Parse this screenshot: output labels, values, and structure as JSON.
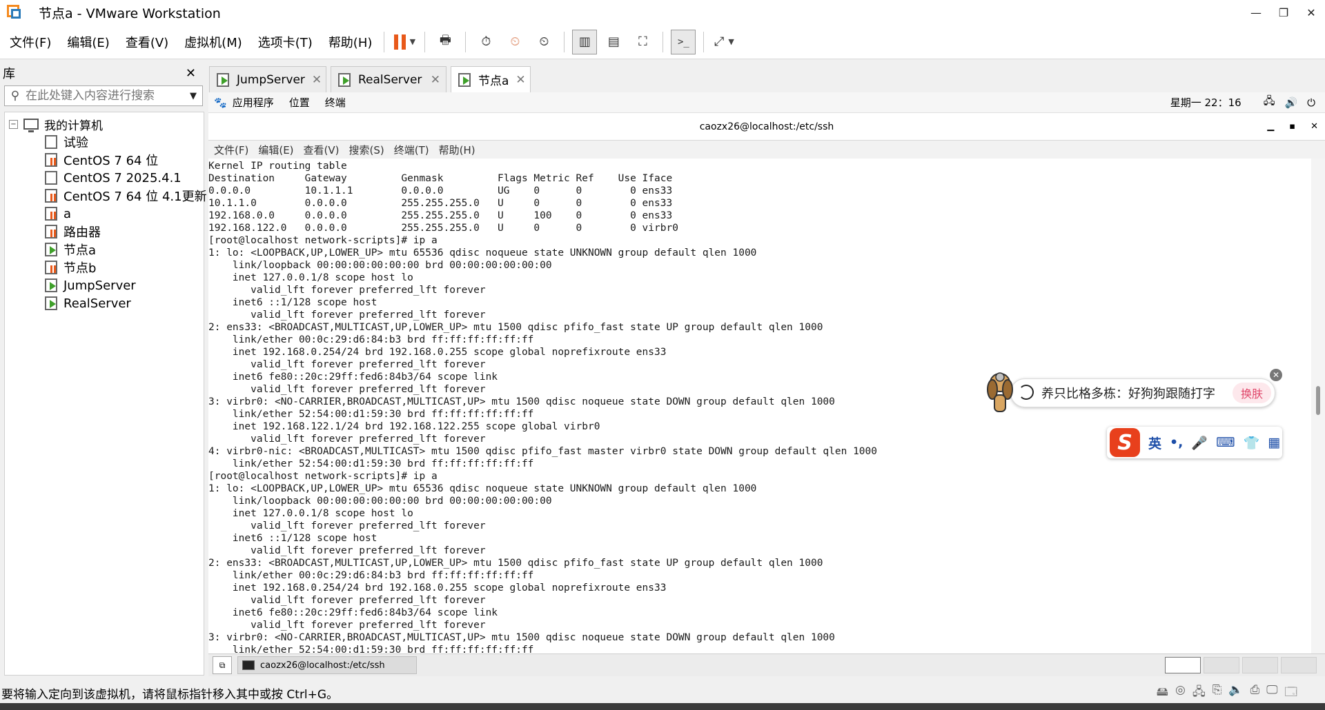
{
  "window": {
    "title": "节点a - VMware Workstation"
  },
  "menu": [
    "文件(F)",
    "编辑(E)",
    "查看(V)",
    "虚拟机(M)",
    "选项卡(T)",
    "帮助(H)"
  ],
  "library": {
    "title": "库",
    "search_placeholder": "在此处键入内容进行搜索",
    "root": "我的计算机",
    "items": [
      {
        "label": "试验",
        "state": "stopped"
      },
      {
        "label": "CentOS 7 64 位",
        "state": "paused"
      },
      {
        "label": "CentOS 7 2025.4.1",
        "state": "stopped"
      },
      {
        "label": "CentOS 7 64 位 4.1更新",
        "state": "paused"
      },
      {
        "label": "a",
        "state": "paused"
      },
      {
        "label": "路由器",
        "state": "paused"
      },
      {
        "label": "节点a",
        "state": "running"
      },
      {
        "label": "节点b",
        "state": "paused"
      },
      {
        "label": "JumpServer",
        "state": "running"
      },
      {
        "label": "RealServer",
        "state": "running"
      }
    ]
  },
  "tabs": [
    {
      "label": "JumpServer",
      "active": false
    },
    {
      "label": "RealServer",
      "active": false
    },
    {
      "label": "节点a",
      "active": true
    }
  ],
  "guest": {
    "top_bar": {
      "apps": "应用程序",
      "places": "位置",
      "terminal": "终端",
      "clock": "星期一 22：16"
    },
    "terminal_title": "caozx26@localhost:/etc/ssh",
    "terminal_menu": [
      "文件(F)",
      "编辑(E)",
      "查看(V)",
      "搜索(S)",
      "终端(T)",
      "帮助(H)"
    ],
    "terminal_lines": [
      "Kernel IP routing table",
      "Destination     Gateway         Genmask         Flags Metric Ref    Use Iface",
      "0.0.0.0         10.1.1.1        0.0.0.0         UG    0      0        0 ens33",
      "10.1.1.0        0.0.0.0         255.255.255.0   U     0      0        0 ens33",
      "192.168.0.0     0.0.0.0         255.255.255.0   U     100    0        0 ens33",
      "192.168.122.0   0.0.0.0         255.255.255.0   U     0      0        0 virbr0",
      "[root@localhost network-scripts]# ip a",
      "1: lo: <LOOPBACK,UP,LOWER_UP> mtu 65536 qdisc noqueue state UNKNOWN group default qlen 1000",
      "    link/loopback 00:00:00:00:00:00 brd 00:00:00:00:00:00",
      "    inet 127.0.0.1/8 scope host lo",
      "       valid_lft forever preferred_lft forever",
      "    inet6 ::1/128 scope host",
      "       valid_lft forever preferred_lft forever",
      "2: ens33: <BROADCAST,MULTICAST,UP,LOWER_UP> mtu 1500 qdisc pfifo_fast state UP group default qlen 1000",
      "    link/ether 00:0c:29:d6:84:b3 brd ff:ff:ff:ff:ff:ff",
      "    inet 192.168.0.254/24 brd 192.168.0.255 scope global noprefixroute ens33",
      "       valid_lft forever preferred_lft forever",
      "    inet6 fe80::20c:29ff:fed6:84b3/64 scope link",
      "       valid_lft forever preferred_lft forever",
      "3: virbr0: <NO-CARRIER,BROADCAST,MULTICAST,UP> mtu 1500 qdisc noqueue state DOWN group default qlen 1000",
      "    link/ether 52:54:00:d1:59:30 brd ff:ff:ff:ff:ff:ff",
      "    inet 192.168.122.1/24 brd 192.168.122.255 scope global virbr0",
      "       valid_lft forever preferred_lft forever",
      "4: virbr0-nic: <BROADCAST,MULTICAST> mtu 1500 qdisc pfifo_fast master virbr0 state DOWN group default qlen 1000",
      "    link/ether 52:54:00:d1:59:30 brd ff:ff:ff:ff:ff:ff",
      "[root@localhost network-scripts]# ip a",
      "1: lo: <LOOPBACK,UP,LOWER_UP> mtu 65536 qdisc noqueue state UNKNOWN group default qlen 1000",
      "    link/loopback 00:00:00:00:00:00 brd 00:00:00:00:00:00",
      "    inet 127.0.0.1/8 scope host lo",
      "       valid_lft forever preferred_lft forever",
      "    inet6 ::1/128 scope host",
      "       valid_lft forever preferred_lft forever",
      "2: ens33: <BROADCAST,MULTICAST,UP,LOWER_UP> mtu 1500 qdisc pfifo_fast state UP group default qlen 1000",
      "    link/ether 00:0c:29:d6:84:b3 brd ff:ff:ff:ff:ff:ff",
      "    inet 192.168.0.254/24 brd 192.168.0.255 scope global noprefixroute ens33",
      "       valid_lft forever preferred_lft forever",
      "    inet6 fe80::20c:29ff:fed6:84b3/64 scope link",
      "       valid_lft forever preferred_lft forever",
      "3: virbr0: <NO-CARRIER,BROADCAST,MULTICAST,UP> mtu 1500 qdisc noqueue state DOWN group default qlen 1000",
      "    link/ether 52:54:00:d1:59:30 brd ff:ff:ff:ff:ff:ff"
    ],
    "taskbar_item": "caozx26@localhost:/etc/ssh"
  },
  "ime_popup": {
    "suggestion": "养只比格多栋：好狗狗跟随打字",
    "swap_label": "换肤",
    "lang": "英"
  },
  "status": {
    "message": "要将输入定向到该虚拟机，请将鼠标指针移入其中或按 Ctrl+G。"
  },
  "colors": {
    "accent_orange": "#e8591a",
    "running_green": "#3fa02a",
    "ime_red": "#e8401c"
  }
}
